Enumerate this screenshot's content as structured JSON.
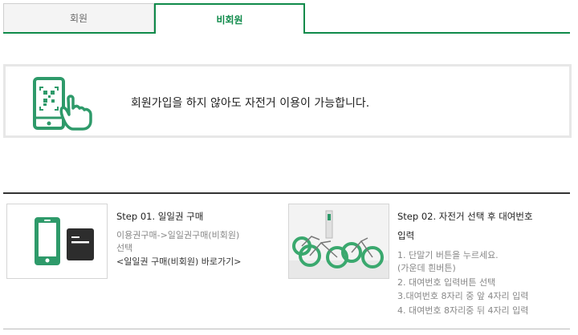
{
  "tabs": {
    "member": "회원",
    "non_member": "비회원"
  },
  "notice": {
    "icon": "phone-qr-tap-icon",
    "text": "회원가입을 하지 않아도 자전거 이용이 가능합니다."
  },
  "step1": {
    "icon": "phone-card-icon",
    "title": "Step 01. 일일권 구매",
    "lines": [
      "이용권구매->일일권구매(비회원)",
      "선택"
    ],
    "link": "<일일권 구매(비회원) 바로가기>"
  },
  "step2": {
    "image": "bicycles-photo",
    "title_line1": "Step 02. 자전거 선택 후 대여번호",
    "title_line2": "입력",
    "lines": [
      "1. 단말기 버튼을 누르세요.",
      "(가운데 흰버튼)",
      "2. 대여번호 입력버튼 선택",
      "3.대여번호 8자리 중 앞 4자리 입력",
      "4. 대여번호 8자리중 뒤 4자리 입력"
    ]
  },
  "colors": {
    "accent": "#0f8a4a",
    "icon_green": "#2e9a6a"
  }
}
